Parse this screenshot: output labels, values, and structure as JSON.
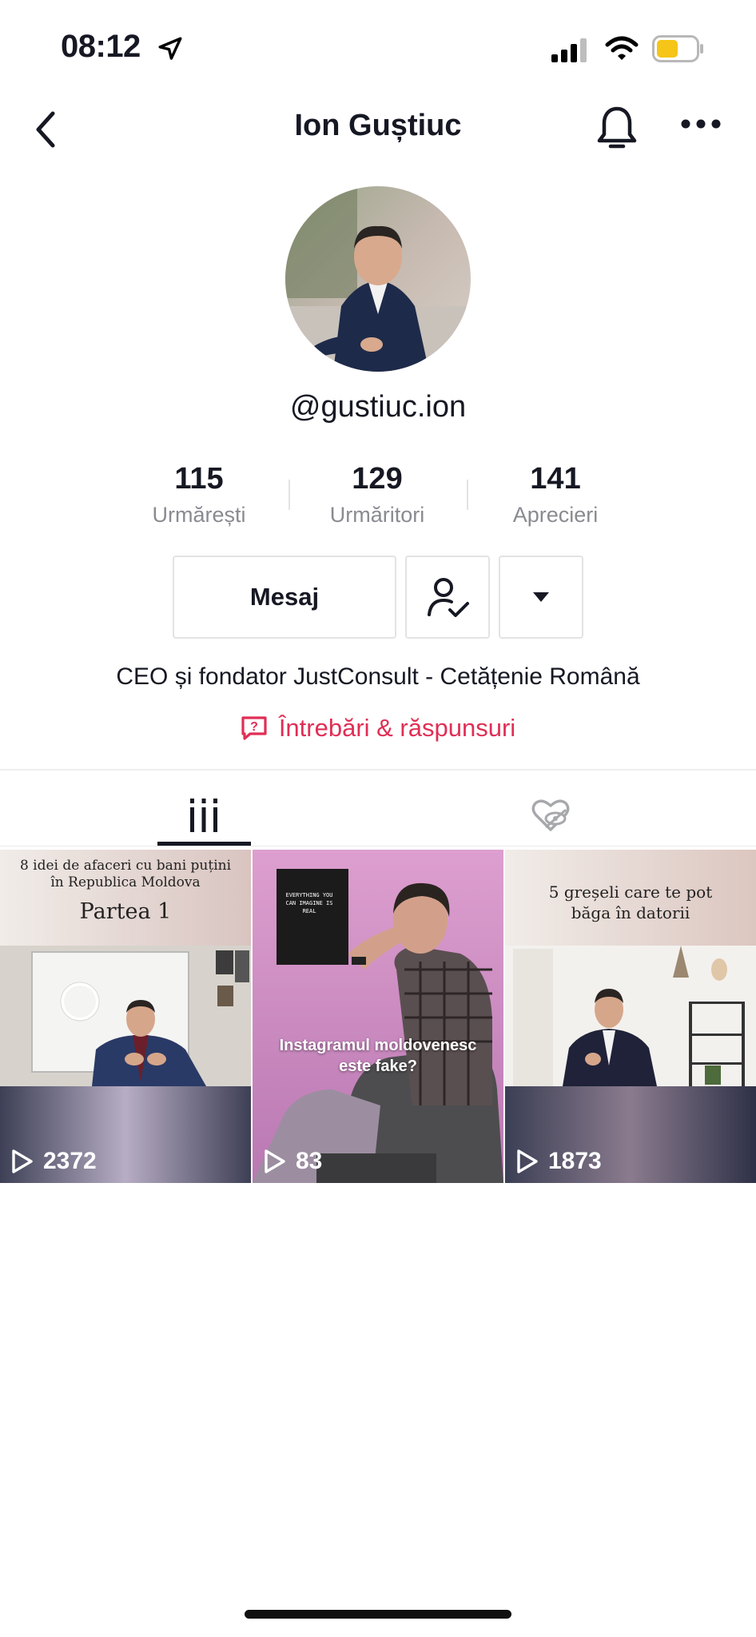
{
  "status_bar": {
    "time": "08:12",
    "battery_color": "#f5c518"
  },
  "header": {
    "title": "Ion Guștiuc"
  },
  "profile": {
    "handle": "@gustiuc.ion",
    "bio": "CEO și fondator JustConsult - Cetățenie Română",
    "qa_link": "Întrebări & răspunsuri"
  },
  "stats": [
    {
      "value": "115",
      "label": "Urmărești"
    },
    {
      "value": "129",
      "label": "Urmăritori"
    },
    {
      "value": "141",
      "label": "Aprecieri"
    }
  ],
  "actions": {
    "message_label": "Mesaj"
  },
  "tabs": [
    {
      "icon": "videos-grid-icon"
    },
    {
      "icon": "liked-hidden-icon"
    }
  ],
  "videos": [
    {
      "caption_line1": "8 idei de afaceri cu bani puțini",
      "caption_line2": "în Republica Moldova",
      "caption_title": "Partea 1",
      "views": "2372"
    },
    {
      "sign_text": "EVERYTHING YOU CAN IMAGINE IS REAL",
      "overlay_line1": "Instagramul moldovenesc",
      "overlay_line2": "este fake?",
      "views": "83"
    },
    {
      "caption_line1": "5 greșeli care te pot",
      "caption_line2": "băga în datorii",
      "views": "1873"
    }
  ],
  "colors": {
    "accent": "#e02e55",
    "text": "#161823",
    "muted": "#8a8b91"
  }
}
